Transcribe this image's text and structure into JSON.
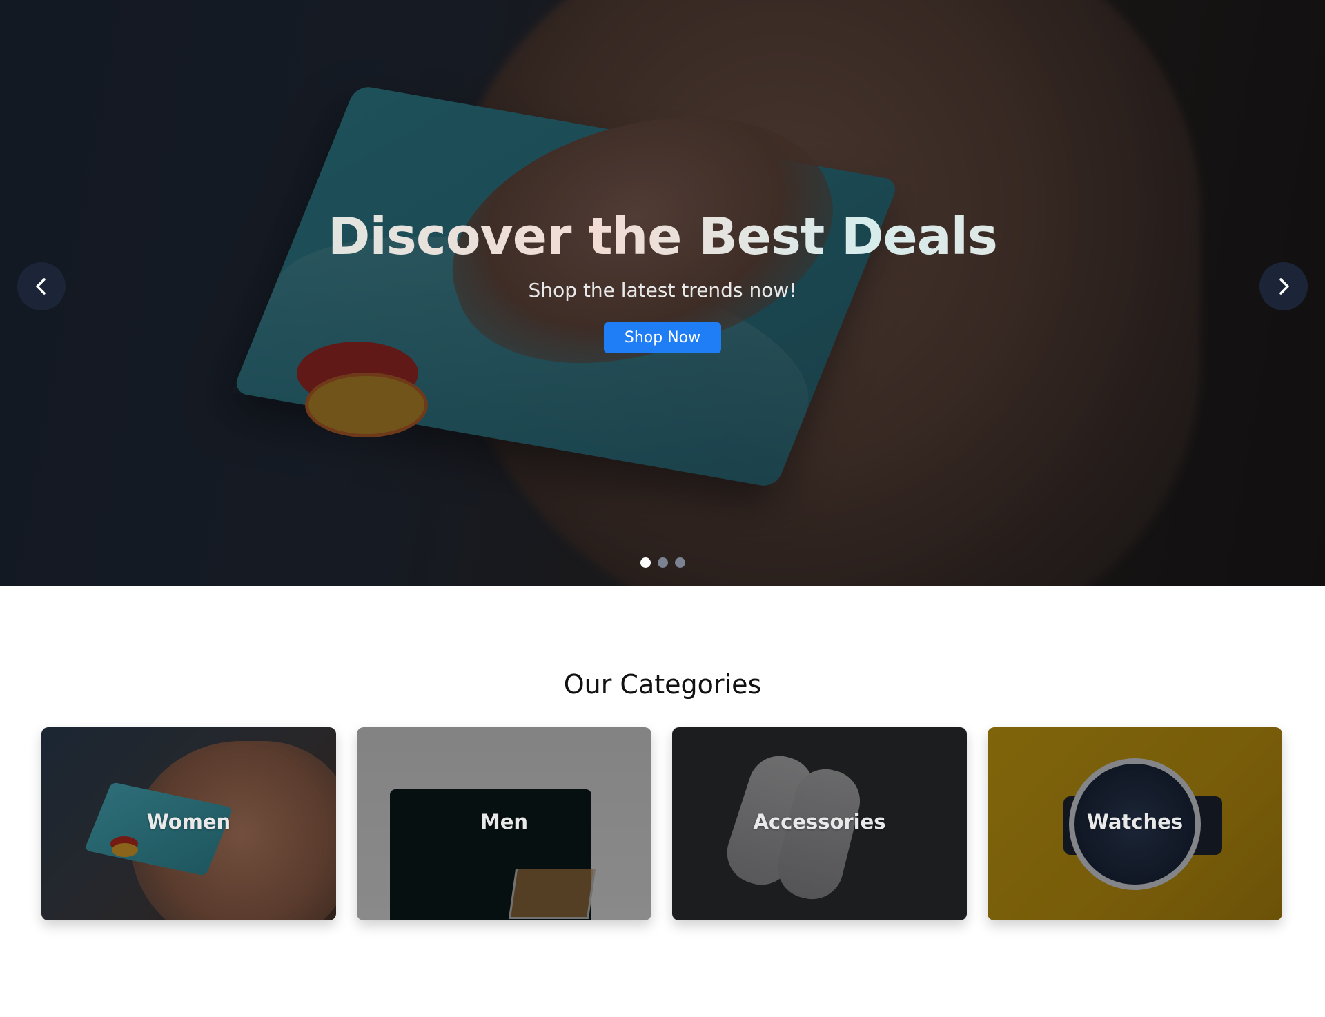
{
  "hero": {
    "title": "Discover the Best Deals",
    "subtitle": "Shop the latest trends now!",
    "cta_label": "Shop Now",
    "prev_icon": "chevron-left-icon",
    "next_icon": "chevron-right-icon",
    "slide_count": 3,
    "active_slide": 1
  },
  "categories": {
    "title": "Our Categories",
    "items": [
      {
        "label": "Women"
      },
      {
        "label": "Men"
      },
      {
        "label": "Accessories"
      },
      {
        "label": "Watches"
      }
    ]
  },
  "colors": {
    "accent": "#1f7ef5",
    "nav_button": "#1c2537",
    "dot_active": "#ffffff",
    "dot_inactive": "#7b8291"
  }
}
